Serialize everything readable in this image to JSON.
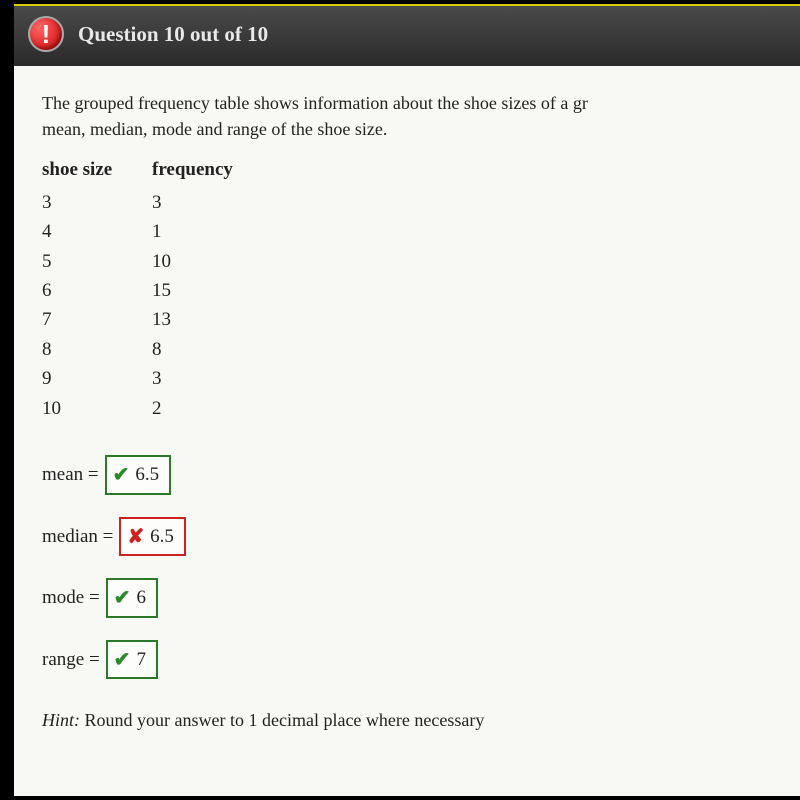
{
  "header": {
    "icon_glyph": "!",
    "title": "Question 10 out of 10"
  },
  "prompt": "The grouped frequency table shows information about the shoe sizes of a gr... mean, median, mode and range of the shoe size.",
  "prompt_line1": "The grouped frequency table shows information about the shoe sizes of a gr",
  "prompt_line2": "mean, median, mode and range of the shoe size.",
  "table": {
    "header_size": "shoe size",
    "header_freq": "frequency",
    "rows": [
      {
        "size": "3",
        "freq": "3"
      },
      {
        "size": "4",
        "freq": "1"
      },
      {
        "size": "5",
        "freq": "10"
      },
      {
        "size": "6",
        "freq": "15"
      },
      {
        "size": "7",
        "freq": "13"
      },
      {
        "size": "8",
        "freq": "8"
      },
      {
        "size": "9",
        "freq": "3"
      },
      {
        "size": "10",
        "freq": "2"
      }
    ]
  },
  "answers": {
    "mean": {
      "label": "mean =",
      "value": "6.5",
      "status": "correct"
    },
    "median": {
      "label": "median =",
      "value": "6.5",
      "status": "wrong"
    },
    "mode": {
      "label": "mode =",
      "value": "6",
      "status": "correct"
    },
    "range": {
      "label": "range =",
      "value": "7",
      "status": "correct"
    }
  },
  "hint_prefix": "Hint:",
  "hint_text": " Round your answer to 1 decimal place where necessary"
}
